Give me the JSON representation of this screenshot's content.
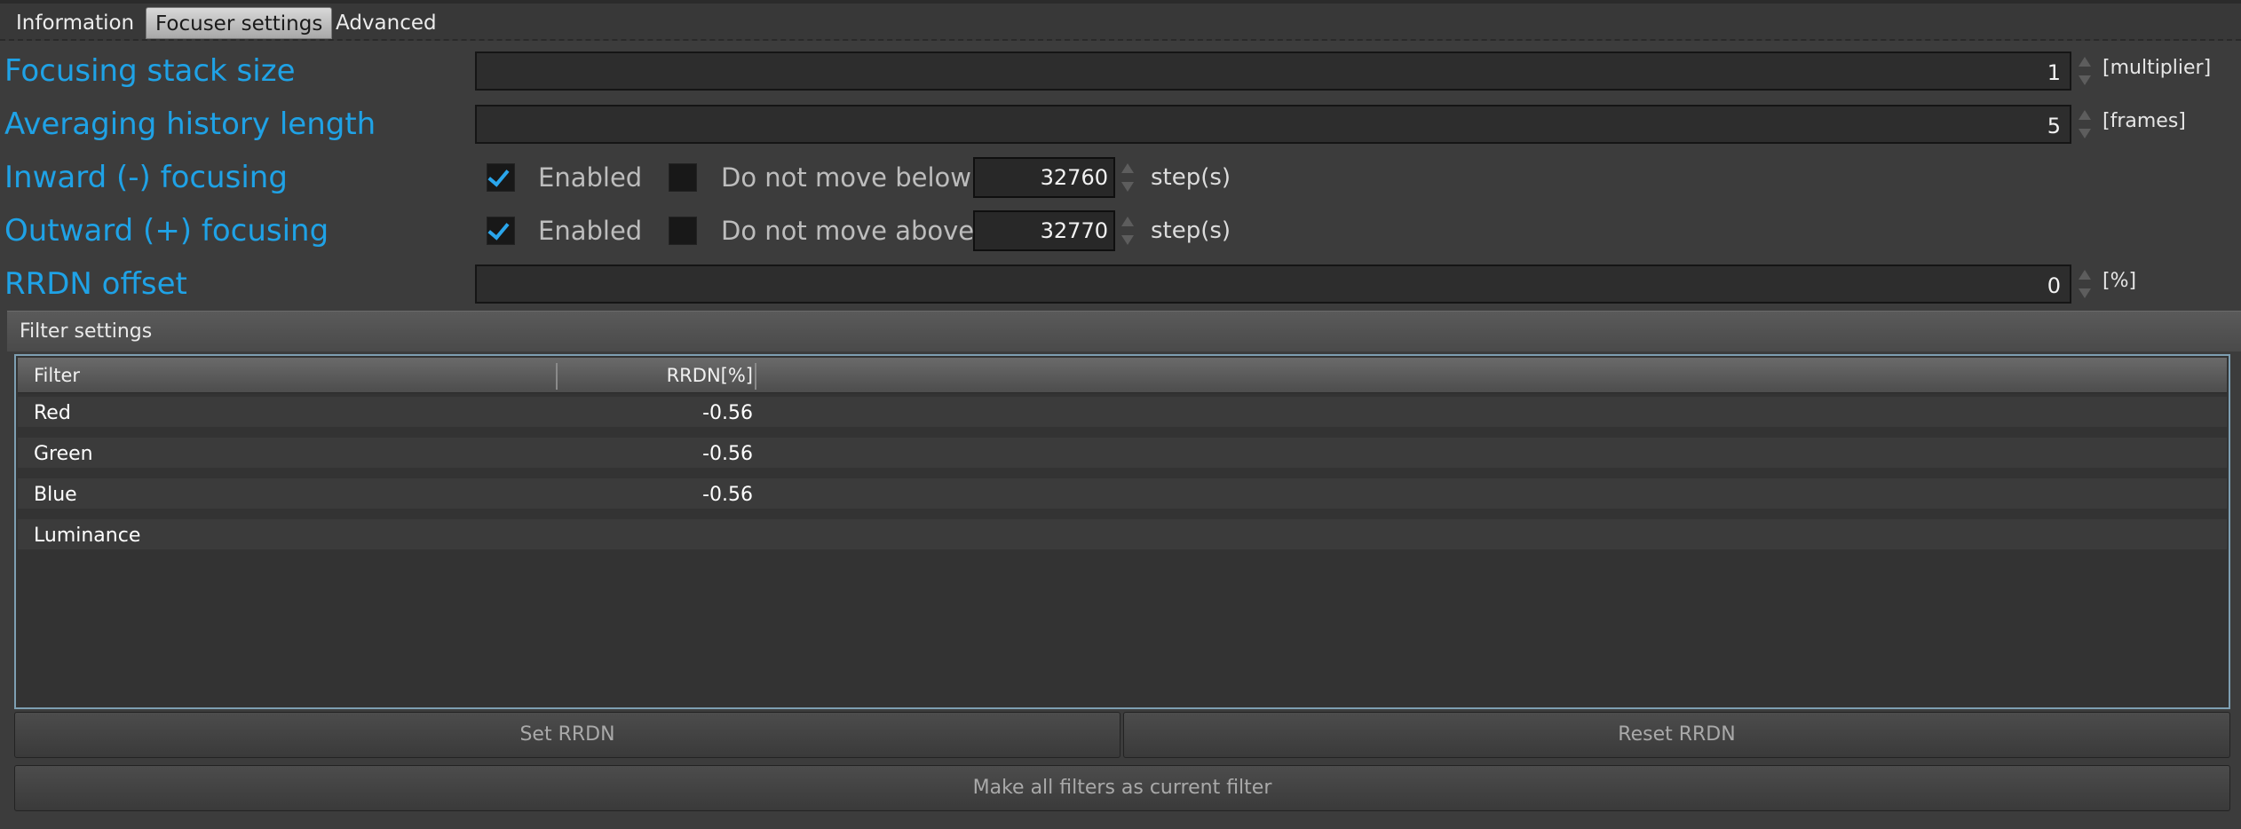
{
  "tabs": [
    {
      "label": "Information"
    },
    {
      "label": "Focuser settings"
    },
    {
      "label": "Advanced"
    }
  ],
  "settings": {
    "stack_size": {
      "label": "Focusing stack size",
      "value": "1",
      "unit": "[multiplier]"
    },
    "history_length": {
      "label": "Averaging history length",
      "value": "5",
      "unit": "[frames]"
    },
    "inward": {
      "label": "Inward (-) focusing",
      "enabled_label": "Enabled",
      "limit_label": "Do not move below",
      "limit_value": "32760",
      "steps_label": "step(s)"
    },
    "outward": {
      "label": "Outward (+) focusing",
      "enabled_label": "Enabled",
      "limit_label": "Do not move above",
      "limit_value": "32770",
      "steps_label": "step(s)"
    },
    "rrdn_offset": {
      "label": "RRDN offset",
      "value": "0",
      "unit": "[%]"
    }
  },
  "filter_settings": {
    "title": "Filter settings",
    "columns": [
      "Filter",
      "RRDN[%]"
    ],
    "rows": [
      {
        "filter": "Red",
        "rrdn": "-0.56"
      },
      {
        "filter": "Green",
        "rrdn": "-0.56"
      },
      {
        "filter": "Blue",
        "rrdn": "-0.56"
      },
      {
        "filter": "Luminance",
        "rrdn": ""
      }
    ]
  },
  "buttons": {
    "set_rrdn": "Set RRDN",
    "reset_rrdn": "Reset RRDN",
    "make_all": "Make all filters as current filter"
  },
  "colors": {
    "accent_label": "#1fa2e6",
    "checkmark": "#2aa6ec",
    "background": "#3c3c3c"
  }
}
